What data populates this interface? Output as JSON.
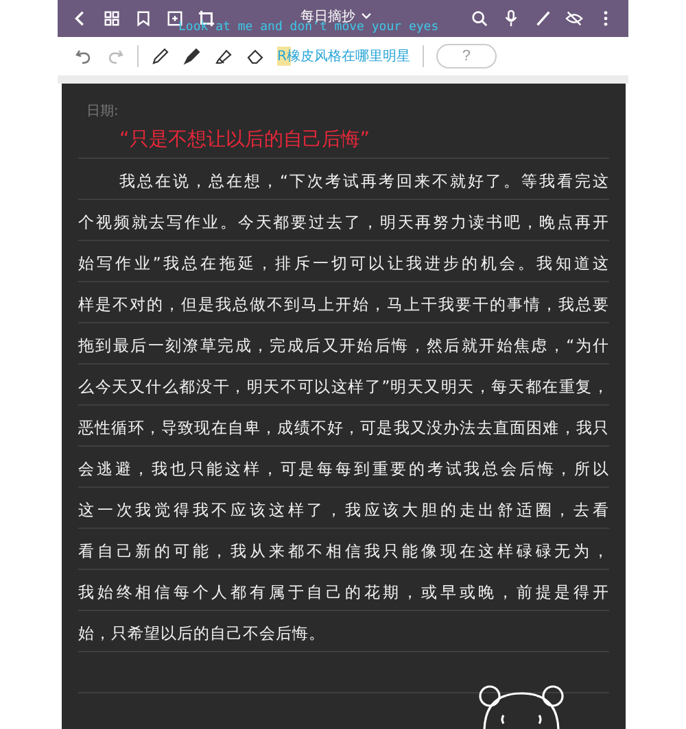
{
  "top_bar": {
    "title": "每日摘抄",
    "caption": "Look at me and don't move your eyes"
  },
  "toolbar": {
    "caption": "R橡皮风格在哪里明星",
    "help": "?"
  },
  "note": {
    "date_label": "日期:",
    "title": "“只是不想让以后的自己后悔”",
    "lines": [
      "我总在说，总在想，“下次考试再考回来不就好了。等我看完这",
      "个视频就去写作业。今天都要过去了，明天再努力读书吧，晚点再开",
      "始写作业”我总在拖延，排斥一切可以让我进步的机会。我知道这",
      "样是不对的，但是我总做不到马上开始，马上干我要干的事情，我总要",
      "拖到最后一刻潦草完成，完成后又开始后悔，然后就开始焦虑，“为什",
      "么今天又什么都没干，明天不可以这样了”明天又明天，每天都在重复，",
      "恶性循环，导致现在自卑，成绩不好，可是我又没办法去直面困难，我只",
      "会逃避，我也只能这样，可是每每到重要的考试我总会后悔，所以",
      "这一次我觉得我不应该这样了，我应该大胆的走出舒适圈，去看",
      "看自己新的可能，我从来都不相信我只能像现在这样碌碌无为，",
      "我始终相信每个人都有属于自己的花期，或早或晚，前提是得开",
      "始，只希望以后的自己不会后悔。"
    ]
  }
}
